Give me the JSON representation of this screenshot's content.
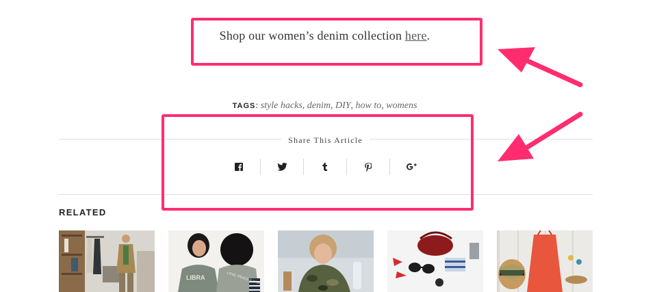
{
  "promo": {
    "text": "Shop our women’s denim collection ",
    "link": "here",
    "suffix": "."
  },
  "tags": {
    "label": "TAGS",
    "separator": ":",
    "items": [
      "style hacks",
      "denim",
      "DIY",
      "how to",
      "womens"
    ]
  },
  "share": {
    "title": "Share This Article",
    "icons": [
      "facebook-icon",
      "twitter-icon",
      "tumblr-icon",
      "pinterest-icon",
      "google-plus-icon"
    ]
  },
  "related": {
    "heading": "RELATED",
    "thumb_texts": [
      "LIBRA",
      "LOVE, PEACE & HARMONY"
    ]
  },
  "colors": {
    "highlight": "#ff2d6f",
    "rule": "#dedede"
  }
}
